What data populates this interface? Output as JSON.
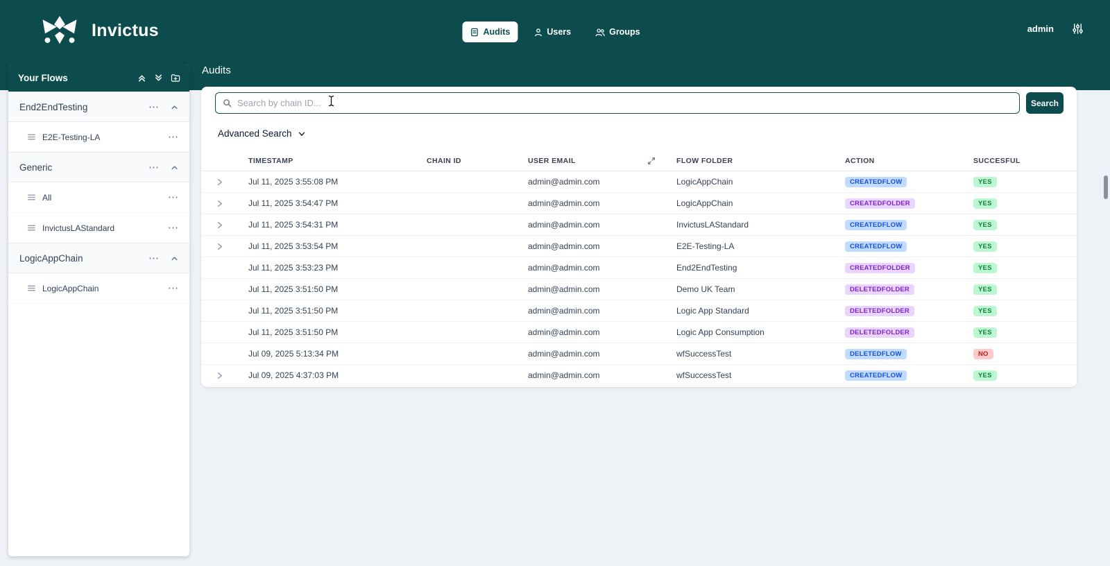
{
  "header": {
    "brand": "Invictus",
    "nav": [
      {
        "label": "Audits",
        "active": true
      },
      {
        "label": "Users",
        "active": false
      },
      {
        "label": "Groups",
        "active": false
      }
    ],
    "user": "admin"
  },
  "sidebar": {
    "title": "Your Flows",
    "groups": [
      {
        "label": "End2EndTesting",
        "children": [
          {
            "label": "E2E-Testing-LA"
          }
        ]
      },
      {
        "label": "Generic",
        "children": [
          {
            "label": "All"
          },
          {
            "label": "InvictusLAStandard"
          }
        ]
      },
      {
        "label": "LogicAppChain",
        "children": [
          {
            "label": "LogicAppChain"
          }
        ]
      }
    ]
  },
  "main": {
    "title": "Audits",
    "search": {
      "placeholder": "Search by chain ID...",
      "value": "",
      "button": "Search"
    },
    "advanced_search": "Advanced Search",
    "table": {
      "headers": [
        "TIMESTAMP",
        "CHAIN ID",
        "USER EMAIL",
        "FLOW FOLDER",
        "ACTION",
        "SUCCESFUL"
      ],
      "rows": [
        {
          "expandable": true,
          "timestamp": "Jul 11, 2025 3:55:08 PM",
          "chain_id": "",
          "user_email": "admin@admin.com",
          "flow_folder": "LogicAppChain",
          "action": "CREATEDFLOW",
          "action_color": "blue",
          "successful": "YES",
          "success_color": "green"
        },
        {
          "expandable": true,
          "timestamp": "Jul 11, 2025 3:54:47 PM",
          "chain_id": "",
          "user_email": "admin@admin.com",
          "flow_folder": "LogicAppChain",
          "action": "CREATEDFOLDER",
          "action_color": "purple",
          "successful": "YES",
          "success_color": "green"
        },
        {
          "expandable": true,
          "timestamp": "Jul 11, 2025 3:54:31 PM",
          "chain_id": "",
          "user_email": "admin@admin.com",
          "flow_folder": "InvictusLAStandard",
          "action": "CREATEDFLOW",
          "action_color": "blue",
          "successful": "YES",
          "success_color": "green"
        },
        {
          "expandable": true,
          "timestamp": "Jul 11, 2025 3:53:54 PM",
          "chain_id": "",
          "user_email": "admin@admin.com",
          "flow_folder": "E2E-Testing-LA",
          "action": "CREATEDFLOW",
          "action_color": "blue",
          "successful": "YES",
          "success_color": "green"
        },
        {
          "expandable": false,
          "timestamp": "Jul 11, 2025 3:53:23 PM",
          "chain_id": "",
          "user_email": "admin@admin.com",
          "flow_folder": "End2EndTesting",
          "action": "CREATEDFOLDER",
          "action_color": "purple",
          "successful": "YES",
          "success_color": "green"
        },
        {
          "expandable": false,
          "timestamp": "Jul 11, 2025 3:51:50 PM",
          "chain_id": "",
          "user_email": "admin@admin.com",
          "flow_folder": "Demo UK Team",
          "action": "DELETEDFOLDER",
          "action_color": "purple",
          "successful": "YES",
          "success_color": "green"
        },
        {
          "expandable": false,
          "timestamp": "Jul 11, 2025 3:51:50 PM",
          "chain_id": "",
          "user_email": "admin@admin.com",
          "flow_folder": "Logic App Standard",
          "action": "DELETEDFOLDER",
          "action_color": "purple",
          "successful": "YES",
          "success_color": "green"
        },
        {
          "expandable": false,
          "timestamp": "Jul 11, 2025 3:51:50 PM",
          "chain_id": "",
          "user_email": "admin@admin.com",
          "flow_folder": "Logic App Consumption",
          "action": "DELETEDFOLDER",
          "action_color": "purple",
          "successful": "YES",
          "success_color": "green"
        },
        {
          "expandable": false,
          "timestamp": "Jul 09, 2025 5:13:34 PM",
          "chain_id": "",
          "user_email": "admin@admin.com",
          "flow_folder": "wfSuccessTest",
          "action": "DELETEDFLOW",
          "action_color": "blue",
          "successful": "NO",
          "success_color": "red"
        },
        {
          "expandable": true,
          "timestamp": "Jul 09, 2025 4:37:03 PM",
          "chain_id": "",
          "user_email": "admin@admin.com",
          "flow_folder": "wfSuccessTest",
          "action": "CREATEDFLOW",
          "action_color": "blue",
          "successful": "YES",
          "success_color": "green"
        }
      ]
    }
  },
  "icons": {
    "logo": "invictus-star",
    "nav_audits": "clipboard",
    "nav_users": "person",
    "nav_groups": "people",
    "header_settings": "sliders",
    "sidebar_collapse_all": "double-chevron-up",
    "sidebar_expand_all": "double-chevron-down",
    "sidebar_add_folder": "folder-plus",
    "group_menu": "ellipsis",
    "group_collapse": "chevron-up",
    "flow_item": "list-lines",
    "search": "magnifier",
    "advanced_search": "chevron-down",
    "email_column": "diagonal-arrows",
    "row_expand": "chevron-right"
  },
  "colors": {
    "teal": "#0d4c4c",
    "page_bg": "#eef1f5",
    "badge_blue_bg": "#bfdbfe",
    "badge_blue_text": "#1d4ed8",
    "badge_purple_bg": "#e9d5ff",
    "badge_purple_text": "#7e22ce",
    "badge_green_bg": "#bbf7d0",
    "badge_green_text": "#15803d",
    "badge_red_bg": "#fecaca",
    "badge_red_text": "#b91c1c"
  }
}
